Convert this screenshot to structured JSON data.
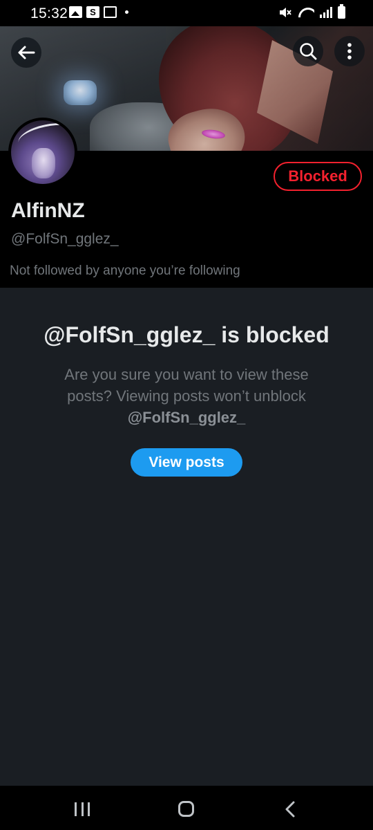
{
  "status_bar": {
    "time": "15:32",
    "left_icons": [
      "gallery-icon",
      "s-app-icon",
      "twitch-icon",
      "dot"
    ],
    "right_icons": [
      "mute-icon",
      "wifi-icon",
      "signal-icon",
      "battery-icon"
    ]
  },
  "header": {
    "back_icon": "arrow-left-icon",
    "search_icon": "search-icon",
    "more_icon": "more-vertical-icon"
  },
  "profile": {
    "blocked_label": "Blocked",
    "display_name": "AlfinNZ",
    "handle": "@FolfSn_gglez_",
    "followed_by": "Not followed by anyone you’re following"
  },
  "blocked_panel": {
    "title": "@FolfSn_gglez_ is blocked",
    "message": "Are you sure you want to view these posts? Viewing posts won’t unblock",
    "message_handle": "@FolfSn_gglez_",
    "view_button": "View posts"
  },
  "navigation_bar": {
    "recents_icon": "recents-icon",
    "home_icon": "home-icon",
    "back_icon": "nav-back-icon"
  },
  "colors": {
    "accent": "#1d9bf0",
    "blocked_red": "#f4212e",
    "panel_bg": "#1a1e23",
    "muted_text": "#71767b"
  }
}
